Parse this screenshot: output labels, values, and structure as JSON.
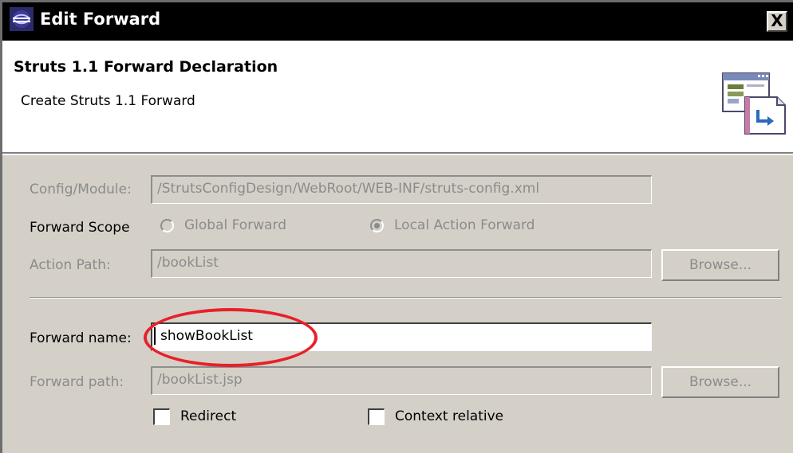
{
  "window": {
    "title": "Edit Forward",
    "close_label": "X"
  },
  "banner": {
    "title": "Struts 1.1 Forward Declaration",
    "subtitle": "Create Struts 1.1 Forward",
    "icon": "struts-forward-wizard-icon"
  },
  "form": {
    "config": {
      "label": "Config/Module:",
      "value": "/StrutsConfigDesign/WebRoot/WEB-INF/struts-config.xml"
    },
    "scope": {
      "label": "Forward Scope",
      "options": [
        {
          "label": "Global Forward",
          "selected": false
        },
        {
          "label": "Local Action Forward",
          "selected": true
        }
      ]
    },
    "action_path": {
      "label": "Action Path:",
      "value": "/bookList",
      "button": "Browse..."
    },
    "forward_name": {
      "label": "Forward name:",
      "value": "showBookList"
    },
    "forward_path": {
      "label": "Forward path:",
      "value": "/bookList.jsp",
      "button": "Browse..."
    },
    "checkboxes": [
      {
        "label": "Redirect",
        "checked": false
      },
      {
        "label": "Context relative",
        "checked": false
      }
    ]
  },
  "colors": {
    "annotation": "#e8202a",
    "titlebar": "#000000",
    "dialog": "#d4d0c8"
  }
}
